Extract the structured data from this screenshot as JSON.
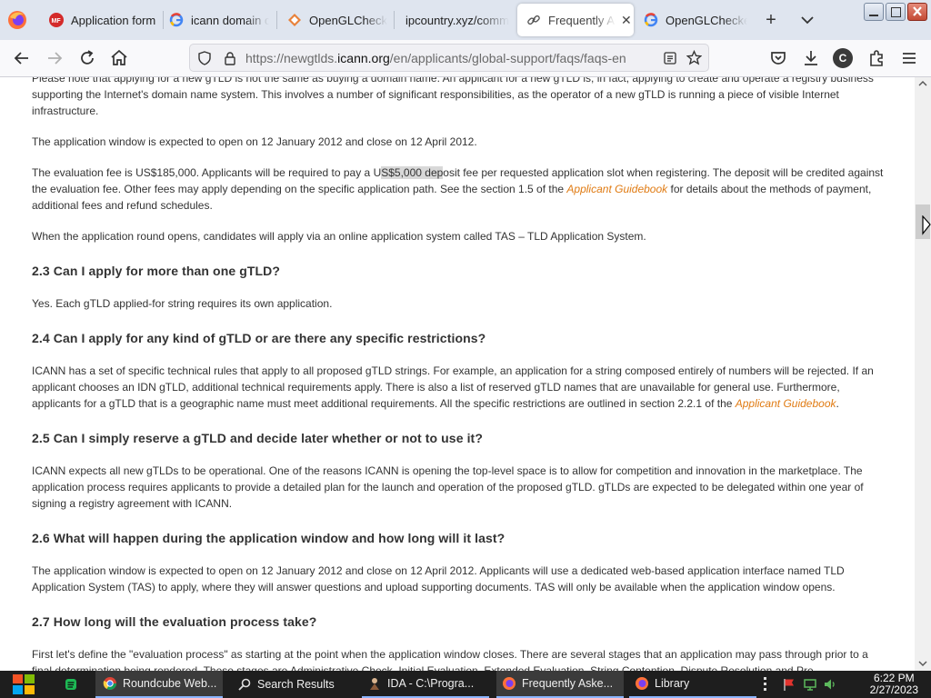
{
  "tabs": [
    {
      "label": "Application form",
      "icon": "mfe-icon"
    },
    {
      "label": "icann domain cr",
      "icon": "google-icon"
    },
    {
      "label": "OpenGLChecker",
      "icon": "opengl-icon"
    },
    {
      "label": "ipcountry.xyz/comm",
      "icon": "none"
    },
    {
      "label": "Frequently Ask",
      "icon": "link-icon",
      "active": true
    },
    {
      "label": "OpenGLChecker",
      "icon": "google-icon"
    }
  ],
  "url": {
    "prefix": "https://newgtlds.",
    "domain": "icann.org",
    "path": "/en/applicants/global-support/faqs/faqs-en"
  },
  "toolbar": {
    "account_initial": "C"
  },
  "article": {
    "intro": "Please note that applying for a new gTLD is not the same as buying a domain name. An applicant for a new gTLD is, in fact, applying to create and operate a registry business supporting the Internet's domain name system. This involves a number of significant responsibilities, as the operator of a new gTLD is running a piece of visible Internet infrastructure.",
    "window_p": "The application window is expected to open on 12 January 2012 and close on 12 April 2012.",
    "fee_a": "The evaluation fee is US$185,000. Applicants will be required to pay a U",
    "fee_hl": "S$5,000 dep",
    "fee_b": "osit fee per requested application slot when registering. The deposit will be credited against the evaluation fee. Other fees may apply depending on the specific application path. See the section 1.5 of the ",
    "fee_link": "Applicant Guidebook",
    "fee_c": " for details about the methods of payment, additional fees and refund schedules.",
    "tas_p": "When the application round opens, candidates will apply via an online application system called TAS – TLD Application System.",
    "h23": "2.3 Can I apply for more than one gTLD?",
    "a23": "Yes. Each gTLD applied-for string requires its own application.",
    "h24": "2.4 Can I apply for any kind of gTLD or are there any specific restrictions?",
    "a24": "ICANN has a set of specific technical rules that apply to all proposed gTLD strings. For example, an application for a string composed entirely of numbers will be rejected. If an applicant chooses an IDN gTLD, additional technical requirements apply. There is also a list of reserved gTLD names that are unavailable for general use. Furthermore, applicants for a gTLD that is a geographic name must meet additional requirements. All the specific restrictions are outlined in section 2.2.1 of the ",
    "a24_link": "Applicant Guidebook",
    "a24_end": ".",
    "h25": "2.5 Can I simply reserve a gTLD and decide later whether or not to use it?",
    "a25": "ICANN expects all new gTLDs to be operational. One of the reasons ICANN is opening the top-level space is to allow for competition and innovation in the marketplace. The application process requires applicants to provide a detailed plan for the launch and operation of the proposed gTLD. gTLDs are expected to be delegated within one year of signing a registry agreement with ICANN.",
    "h26": "2.6 What will happen during the application window and how long will it last?",
    "a26": "The application window is expected to open on 12 January 2012 and close on 12 April 2012. Applicants will use a dedicated web-based application interface named TLD Application System (TAS) to apply, where they will answer questions and upload supporting documents. TAS will only be available when the application window opens.",
    "h27": "2.7 How long will the evaluation process take?",
    "a27": "First let's define the \"evaluation process\" as starting at the point when the application window closes. There are several stages that an application may pass through prior to a final determination being rendered. These stages are Administrative Check, Initial Evaluation, Extended Evaluation, String Contention, Dispute Resolution and Pre"
  },
  "taskbar": {
    "items": [
      {
        "label": "Roundcube Web...",
        "icon": "chrome-icon"
      },
      {
        "label": "Search Results",
        "icon": "search-icon"
      },
      {
        "label": "IDA - C:\\Progra...",
        "icon": "ida-icon"
      },
      {
        "label": "Frequently Aske...",
        "icon": "firefox-icon"
      },
      {
        "label": "Library",
        "icon": "firefox-icon"
      }
    ],
    "time": "6:22 PM",
    "date": "2/27/2023"
  }
}
